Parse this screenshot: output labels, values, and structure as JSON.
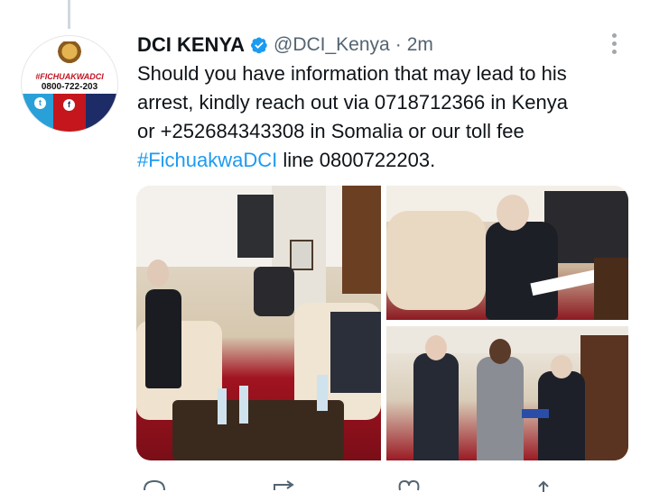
{
  "tweet": {
    "author_name": "DCI KENYA",
    "handle": "@DCI_Kenya",
    "separator": "·",
    "time": "2m",
    "text_lines": [
      "Should you have information that may lead to his",
      "arrest, kindly reach out via 0718712366 in Kenya",
      "or +252684343308 in Somalia or our toll fee"
    ],
    "hashtag": "#FichuakwaDCI",
    "last_line_rest": " line 0800722203."
  },
  "avatar": {
    "tag": "#FICHUAKWADCI",
    "phone": "0800-722-203"
  },
  "colors": {
    "link": "#1d9bf0",
    "secondary_text": "#536471",
    "verified": "#1d9bf0"
  },
  "icons": [
    "verified-badge-icon",
    "more-options-icon",
    "reply-icon",
    "retweet-icon",
    "like-icon",
    "share-icon"
  ]
}
